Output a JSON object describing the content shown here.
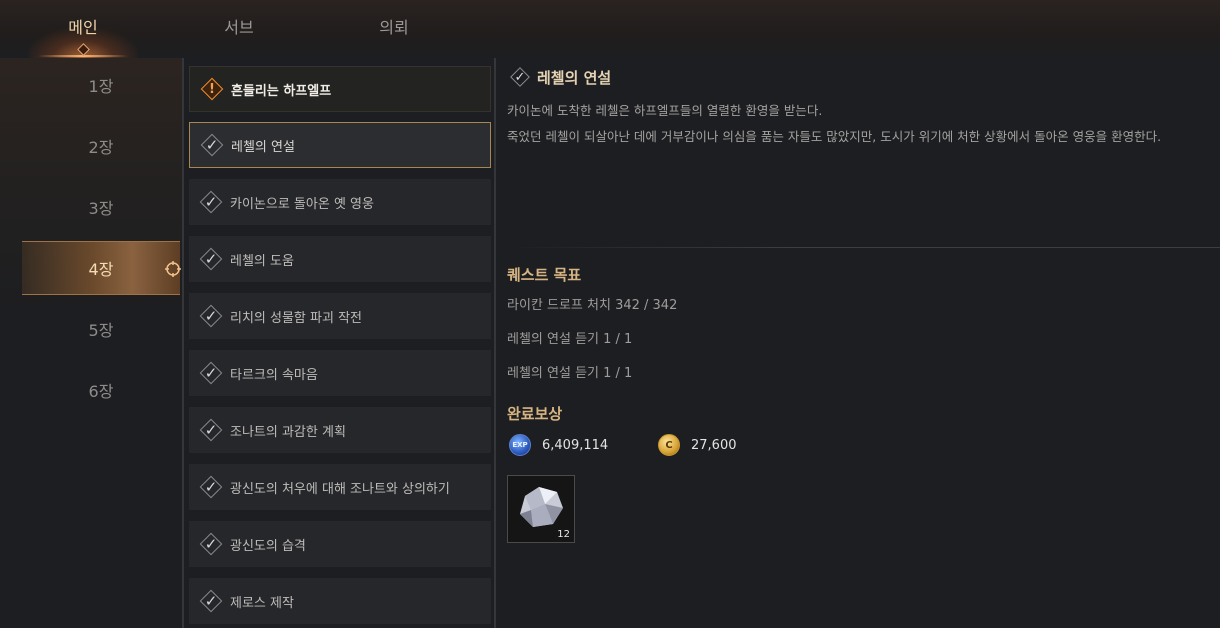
{
  "tabs": [
    {
      "label": "메인",
      "active": true
    },
    {
      "label": "서브",
      "active": false
    },
    {
      "label": "의뢰",
      "active": false
    }
  ],
  "chapters": [
    {
      "label": "1장",
      "active": false
    },
    {
      "label": "2장",
      "active": false
    },
    {
      "label": "3장",
      "active": false
    },
    {
      "label": "4장",
      "active": true
    },
    {
      "label": "5장",
      "active": false
    },
    {
      "label": "6장",
      "active": false
    }
  ],
  "quests": [
    {
      "label": "흔들리는 하프엘프",
      "state": "current"
    },
    {
      "label": "레첼의 연설",
      "state": "selected"
    },
    {
      "label": "카이논으로 돌아온 옛 영웅",
      "state": "completed"
    },
    {
      "label": "레첼의 도움",
      "state": "completed"
    },
    {
      "label": "리치의 성물함 파괴 작전",
      "state": "completed"
    },
    {
      "label": "타르크의 속마음",
      "state": "completed"
    },
    {
      "label": "조나트의 과감한 계획",
      "state": "completed"
    },
    {
      "label": "광신도의 처우에 대해 조나트와 상의하기",
      "state": "completed"
    },
    {
      "label": "광신도의 습격",
      "state": "completed"
    },
    {
      "label": "제로스 제작",
      "state": "completed"
    }
  ],
  "detail": {
    "title": "레첼의 연설",
    "description": [
      "카이논에 도착한 레첼은 하프엘프들의 열렬한 환영을 받는다.",
      "죽었던 레첼이 되살아난 데에 거부감이나 의심을 품는 자들도 많았지만, 도시가 위기에 처한 상황에서 돌아온 영웅을 환영한다."
    ],
    "objectives_title": "퀘스트 목표",
    "objectives": [
      "라이칸 드로프 처치 342 / 342",
      "레첼의 연설 듣기 1 / 1",
      "레첼의 연설 듣기 1 / 1"
    ],
    "rewards_title": "완료보상",
    "rewards": {
      "exp_icon_text": "EXP",
      "exp": "6,409,114",
      "gold_icon_text": "C",
      "gold": "27,600"
    },
    "item": {
      "icon": "crystal-icon",
      "count": "12"
    }
  },
  "colors": {
    "accent": "#d7b583",
    "active_tab": "#f1d3a8",
    "selected_border": "#a7864f",
    "current_quest_icon": "#f08d2b"
  }
}
